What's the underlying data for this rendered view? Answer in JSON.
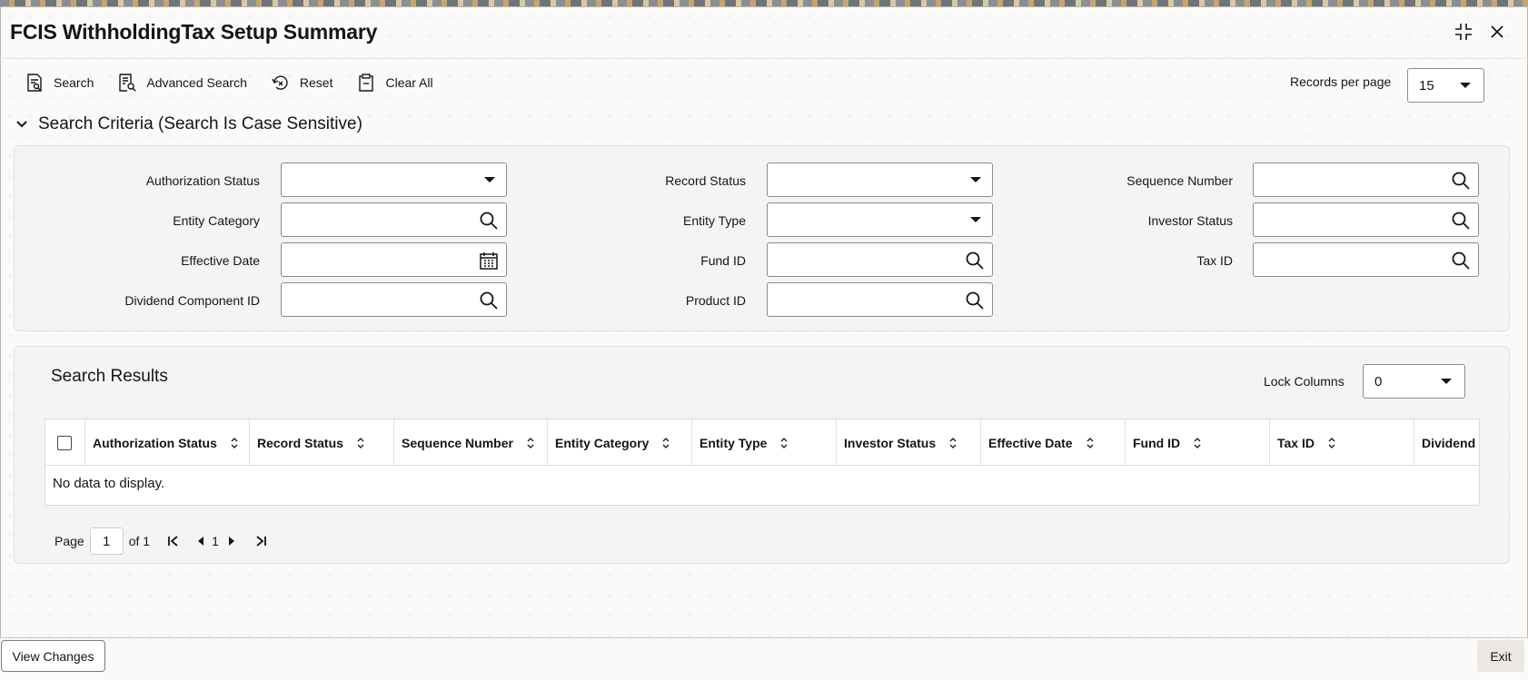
{
  "window": {
    "title": "FCIS WithholdingTax Setup Summary"
  },
  "toolbar": {
    "search": "Search",
    "advanced_search": "Advanced Search",
    "reset": "Reset",
    "clear_all": "Clear All"
  },
  "records_per_page": {
    "label": "Records per page",
    "value": "15"
  },
  "search_criteria": {
    "title": "Search Criteria (Search Is Case Sensitive)",
    "fields": {
      "authorization_status": "Authorization Status",
      "record_status": "Record Status",
      "sequence_number": "Sequence Number",
      "entity_category": "Entity Category",
      "entity_type": "Entity Type",
      "investor_status": "Investor Status",
      "effective_date": "Effective Date",
      "fund_id": "Fund ID",
      "tax_id": "Tax ID",
      "dividend_component_id": "Dividend Component ID",
      "product_id": "Product ID"
    }
  },
  "results": {
    "title": "Search Results",
    "lock_columns_label": "Lock Columns",
    "lock_columns_value": "0",
    "columns": [
      "Authorization Status",
      "Record Status",
      "Sequence Number",
      "Entity Category",
      "Entity Type",
      "Investor Status",
      "Effective Date",
      "Fund ID",
      "Tax ID",
      "Dividend C"
    ],
    "empty_message": "No data to display."
  },
  "pager": {
    "page_label": "Page",
    "page_value": "1",
    "of_label": "of 1",
    "current": "1"
  },
  "footer": {
    "view_changes": "View Changes",
    "exit": "Exit"
  }
}
